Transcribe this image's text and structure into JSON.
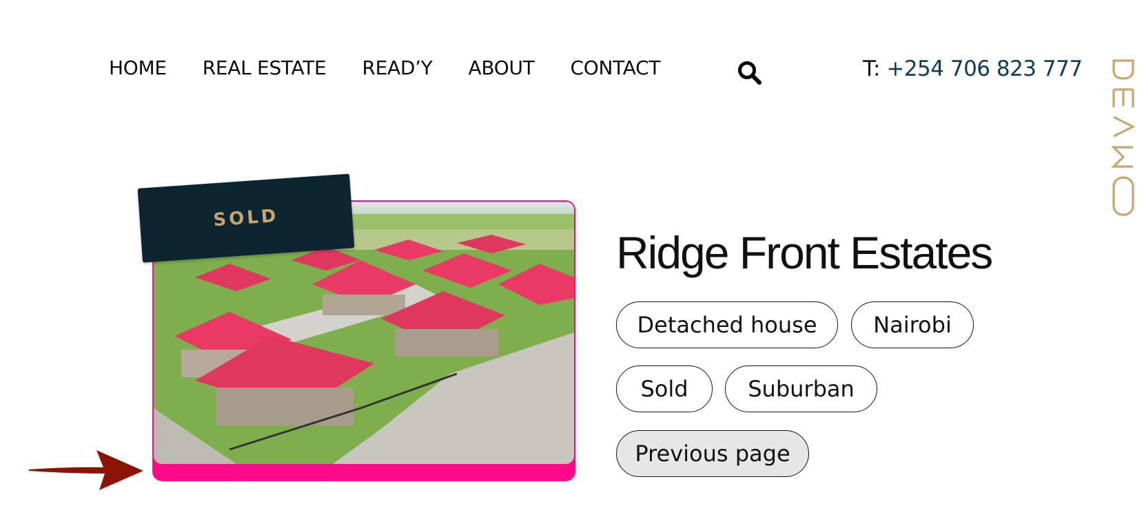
{
  "nav": {
    "items": [
      {
        "label": "HOME"
      },
      {
        "label": "REAL ESTATE"
      },
      {
        "label": "READ’Y"
      },
      {
        "label": "ABOUT"
      },
      {
        "label": "CONTACT"
      }
    ],
    "search_icon": "search-icon"
  },
  "contact": {
    "prefix": "T:",
    "phone": "+254 706 823 777"
  },
  "brand": {
    "logo_text": "DEAMO",
    "logo_color": "#c9a66f"
  },
  "listing": {
    "status_label": "SOLD",
    "title": "Ridge Front Estates",
    "tags": [
      "Detached house",
      "Nairobi",
      "Sold",
      "Suburban"
    ],
    "previous_label": "Previous page",
    "accent_color": "#fc0a8a",
    "tag_color": "#0c2530",
    "arrow_color": "#8c1306"
  }
}
